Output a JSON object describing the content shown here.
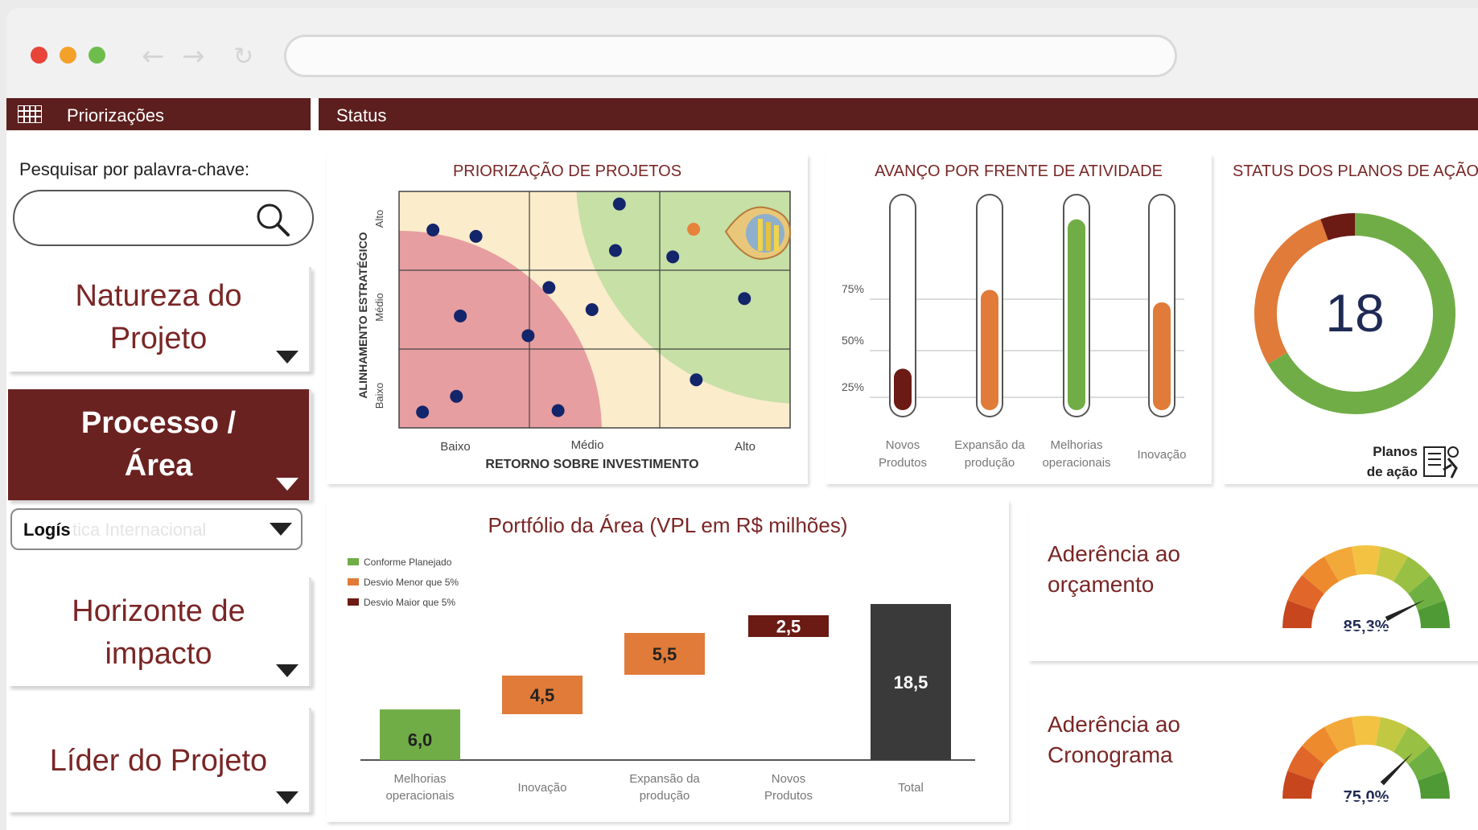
{
  "browser": {
    "window_buttons": {
      "close_color": "#e8443a",
      "minimize_color": "#f4a12b",
      "maximize_color": "#6ebd4c"
    }
  },
  "header": {
    "left_title": "Priorizações",
    "right_title": "Status"
  },
  "sidebar": {
    "search_label": "Pesquisar por palavra-chave:",
    "search_placeholder": "",
    "filters": [
      {
        "line1": "Natureza do",
        "line2": "Projeto",
        "active": false
      },
      {
        "line1": "Processo /",
        "line2": "Área",
        "active": true
      },
      {
        "line1": "Horizonte de",
        "line2": "impacto",
        "active": false
      },
      {
        "line1": "Líder do Projeto",
        "line2": "",
        "active": false
      }
    ],
    "area_select": {
      "typed": "Logís",
      "suggestion": "tica Internacional"
    }
  },
  "scatter": {
    "title": "PRIORIZAÇÃO DE PROJETOS",
    "xlabel": "RETORNO SOBRE INVESTIMENTO",
    "ylabel": "ALINHAMENTO ESTRATÉGICO",
    "xticks": [
      "Baixo",
      "Médio",
      "Alto"
    ],
    "yticks": [
      "Baixo",
      "Médio",
      "Alto"
    ]
  },
  "thermo": {
    "title": "AVANÇO POR FRENTE DE ATIVIDADE",
    "ticks": [
      "25%",
      "50%",
      "75%"
    ]
  },
  "donut": {
    "title": "STATUS DOS PLANOS DE AÇÃO",
    "center_value": "18",
    "legend_line1": "Planos",
    "legend_line2": "de ação"
  },
  "waterfall": {
    "title": "Portfólio da Área (VPL em R$ milhões)"
  },
  "gauges": [
    {
      "line1": "Aderência ao",
      "line2": "orçamento",
      "value_label": "85,3%"
    },
    {
      "line1": "Aderência ao",
      "line2": "Cronograma",
      "value_label": "75,0%"
    }
  ],
  "colors": {
    "brand": "#5c1f1e",
    "green": "#70ad47",
    "orange": "#e07b39",
    "dark_red": "#6b1a14",
    "dark_gray": "#3a3a3a"
  },
  "chart_data": [
    {
      "type": "scatter",
      "title": "PRIORIZAÇÃO DE PROJETOS",
      "xlabel": "RETORNO SOBRE INVESTIMENTO",
      "ylabel": "ALINHAMENTO ESTRATÉGICO",
      "xticks": [
        "Baixo",
        "Médio",
        "Alto"
      ],
      "yticks": [
        "Baixo",
        "Médio",
        "Alto"
      ],
      "xlim": [
        0,
        3
      ],
      "ylim": [
        0,
        3
      ],
      "points": [
        {
          "x": 0.26,
          "y": 2.51
        },
        {
          "x": 0.59,
          "y": 2.43
        },
        {
          "x": 1.69,
          "y": 2.84
        },
        {
          "x": 1.66,
          "y": 2.25
        },
        {
          "x": 2.1,
          "y": 2.17
        },
        {
          "x": 1.15,
          "y": 1.78
        },
        {
          "x": 1.48,
          "y": 1.5
        },
        {
          "x": 0.47,
          "y": 1.42
        },
        {
          "x": 0.99,
          "y": 1.17
        },
        {
          "x": 2.65,
          "y": 1.64
        },
        {
          "x": 2.28,
          "y": 0.61
        },
        {
          "x": 0.44,
          "y": 0.4
        },
        {
          "x": 0.18,
          "y": 0.2
        },
        {
          "x": 1.22,
          "y": 0.22
        }
      ],
      "highlight": {
        "x": 2.26,
        "y": 2.52
      }
    },
    {
      "type": "bar",
      "title": "AVANÇO POR FRENTE DE ATIVIDADE",
      "categories": [
        "Novos Produtos",
        "Expansão da produção",
        "Melhorias operacionais",
        "Inovação"
      ],
      "values": [
        20,
        58,
        92,
        52
      ],
      "ylim": [
        0,
        100
      ],
      "yticks": [
        "25%",
        "50%",
        "75%"
      ]
    },
    {
      "type": "pie",
      "title": "STATUS DOS PLANOS DE AÇÃO",
      "total": "18",
      "values": [
        12,
        5,
        1
      ]
    },
    {
      "type": "bar",
      "title": "Portfólio da Área (VPL em R$ milhões)",
      "categories": [
        "Melhorias operacionais",
        "Inovação",
        "Expansão da produção",
        "Novos Produtos",
        "Total"
      ],
      "values": [
        6.0,
        4.5,
        5.5,
        2.5,
        18.5
      ],
      "labels": [
        "6,0",
        "4,5",
        "5,5",
        "2,5",
        "18,5"
      ],
      "legend": [
        "Conforme Planejado",
        "Desvio Menor que 5%",
        "Desvio Maior que 5%"
      ]
    },
    {
      "type": "gauge",
      "title": "Aderência ao orçamento",
      "value": 85.3,
      "label": "85,3%"
    },
    {
      "type": "gauge",
      "title": "Aderência ao Cronograma",
      "value": 75.0,
      "label": "75,0%"
    }
  ]
}
